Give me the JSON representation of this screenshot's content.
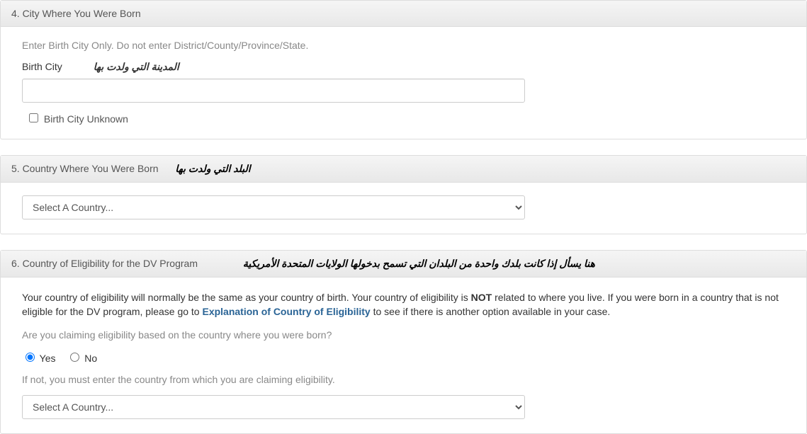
{
  "section4": {
    "title": "4. City Where You Were Born",
    "hint": "Enter Birth City Only. Do not enter District/County/Province/State.",
    "label": "Birth City",
    "arabic": "المدينة التي ولدت بها",
    "input_value": "",
    "checkbox_label": "Birth City Unknown"
  },
  "section5": {
    "title": "5. Country Where You Were Born",
    "arabic": "البلد التي ولدت بها",
    "select_placeholder": "Select A Country..."
  },
  "section6": {
    "title": "6. Country of Eligibility for the DV Program",
    "arabic": "هنا يسأل إذا كانت بلدك واحدة من البلدان التي تسمح بدخولها الولايات المتحدة الأمريكية",
    "para_before": "Your country of eligibility will normally be the same as your country of birth. Your country of eligibility is ",
    "para_bold": "NOT",
    "para_mid": " related to where you live. If you were born in a country that is not eligible for the DV program, please go to ",
    "link_text": "Explanation of Country of Eligibility",
    "para_after": " to see if there is another option available in your case.",
    "question": "Are you claiming eligibility based on the country where you were born?",
    "opt_yes": "Yes",
    "opt_no": "No",
    "ifnot": "If not, you must enter the country from which you are claiming eligibility.",
    "select_placeholder": "Select A Country..."
  }
}
